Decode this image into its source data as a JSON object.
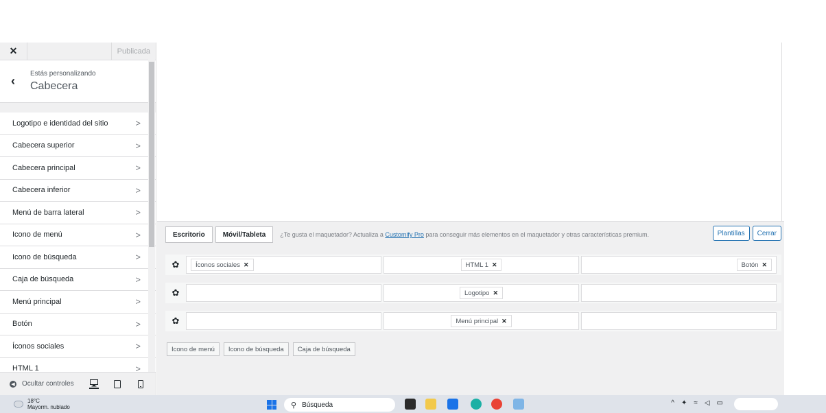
{
  "sidebar": {
    "publish_label": "Publicada",
    "crumb_small": "Estás personalizando",
    "crumb_title": "Cabecera",
    "items": [
      {
        "label": "Logotipo e identidad del sitio"
      },
      {
        "label": "Cabecera superior"
      },
      {
        "label": "Cabecera principal"
      },
      {
        "label": "Cabecera inferior"
      },
      {
        "label": "Menú de barra lateral"
      },
      {
        "label": "Icono de menú"
      },
      {
        "label": "Icono de búsqueda"
      },
      {
        "label": "Caja de búsqueda"
      },
      {
        "label": "Menú principal"
      },
      {
        "label": "Botón"
      },
      {
        "label": "Íconos sociales"
      },
      {
        "label": "HTML 1"
      }
    ],
    "hide_controls": "Ocultar controles"
  },
  "builder": {
    "tabs": [
      "Escritorio",
      "Móvil/Tableta"
    ],
    "promo_before": "¿Te gusta el maquetador? Actualiza a ",
    "promo_link": "Customify Pro",
    "promo_after": " para conseguir más elementos en el maquetador y otras características premium.",
    "buttons": [
      "Plantillas",
      "Cerrar"
    ],
    "rows": [
      {
        "left": "Íconos sociales",
        "center": "HTML 1",
        "right": "Botón"
      },
      {
        "left": "",
        "center": "Logotipo",
        "right": ""
      },
      {
        "left": "",
        "center": "Menú principal",
        "right": ""
      }
    ],
    "available": [
      "Icono de menú",
      "Icono de búsqueda",
      "Caja de búsqueda"
    ]
  },
  "taskbar": {
    "temp": "18°C",
    "weather": "Mayorm. nublado",
    "search": "Búsqueda"
  },
  "colors": {
    "accent": "#2271b1",
    "sidebar_bg": "#f0f0f1",
    "taskbar_bg": "#dfe3ea"
  }
}
